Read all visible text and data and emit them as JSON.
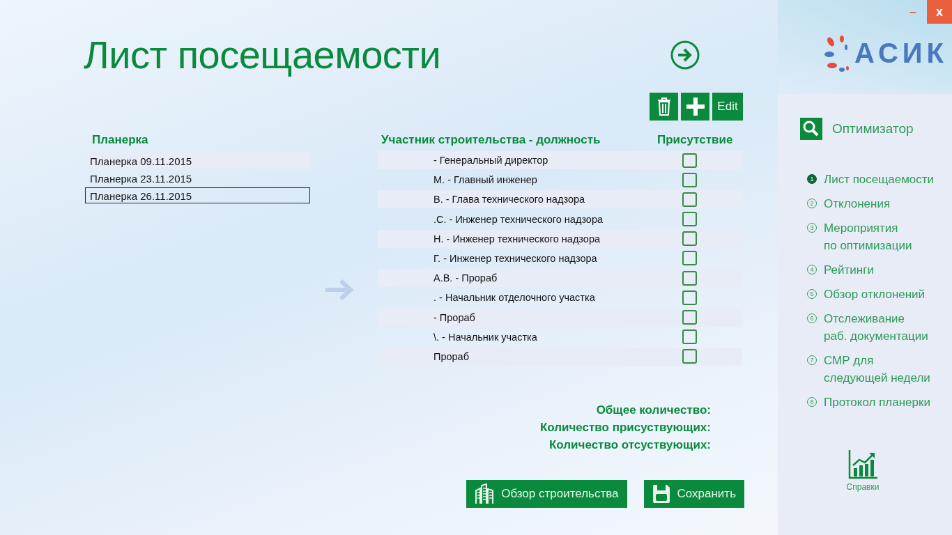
{
  "window": {
    "title": "Лист посещаемости",
    "minimize": "–",
    "close": "x"
  },
  "logo": {
    "text": "АСИК"
  },
  "toolbar": [
    {
      "kind": "delete"
    },
    {
      "kind": "add"
    },
    {
      "kind": "text",
      "label": "Edit"
    }
  ],
  "meetings": {
    "heading": "Планерка",
    "items": [
      {
        "label": "Планерка 09.11.2015",
        "selected": false
      },
      {
        "label": "Планерка 23.11.2015",
        "selected": false
      },
      {
        "label": "Планерка 26.11.2015",
        "selected": true
      }
    ]
  },
  "attendance": {
    "columns": [
      "Участник строительства - должность",
      "Присутствие"
    ],
    "rows": [
      {
        "participant": "- Генеральный директор",
        "present": false
      },
      {
        "participant": "М. - Главный инженер",
        "present": false
      },
      {
        "participant": "В. - Глава технического надзора",
        "present": false
      },
      {
        "participant": ".С. - Инженер технического надзора",
        "present": false
      },
      {
        "participant": "Н. - Инженер технического надзора",
        "present": false
      },
      {
        "participant": "Г. - Инженер технического надзора",
        "present": false
      },
      {
        "participant": "А.В. - Прораб",
        "present": false
      },
      {
        "participant": ". - Начальник отделочного участка",
        "present": false
      },
      {
        "participant": "- Прораб",
        "present": false
      },
      {
        "participant": "\\. - Начальник участка",
        "present": false
      },
      {
        "participant": "Прораб",
        "present": false
      }
    ]
  },
  "totals": [
    "Общее количество:",
    "Количество присуствующих:",
    "Количество отсуствующих:"
  ],
  "actions": [
    {
      "kind": "buildings",
      "label": "Обзор строительства"
    },
    {
      "kind": "save",
      "label": "Сохранить"
    }
  ],
  "sidebar": {
    "header": "Оптимизатор",
    "items": [
      {
        "number": "1",
        "label": "Лист посещаемости",
        "selected": true
      },
      {
        "number": "2",
        "label": "Отклонения",
        "selected": false
      },
      {
        "number": "3",
        "label": "Мероприятия\nпо оптимизации",
        "selected": false
      },
      {
        "number": "4",
        "label": "Рейтинги",
        "selected": false
      },
      {
        "number": "5",
        "label": "Обзор отклонений",
        "selected": false
      },
      {
        "number": "6",
        "label": "Отслеживание\nраб. документации",
        "selected": false
      },
      {
        "number": "7",
        "label": "СМР для\nследующей недели",
        "selected": false
      },
      {
        "number": "8",
        "label": "Протокол планерки",
        "selected": false
      }
    ],
    "footer": "Справки"
  }
}
